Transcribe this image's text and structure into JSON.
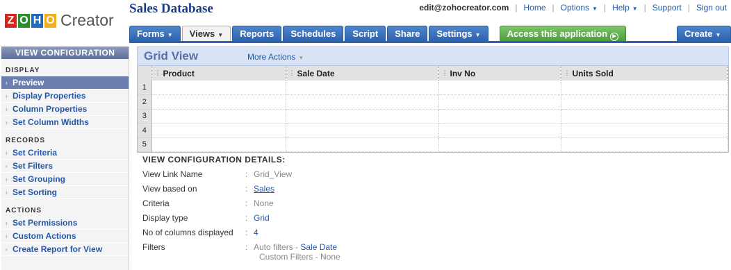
{
  "brand": {
    "logo_letters": [
      "Z",
      "O",
      "H",
      "O"
    ],
    "logo_word": "Creator"
  },
  "app_title": "Sales Database",
  "top_links": {
    "email": "edit@zohocreator.com",
    "home": "Home",
    "options": "Options",
    "help": "Help",
    "support": "Support",
    "sign_out": "Sign out"
  },
  "tabs": [
    {
      "label": "Forms",
      "has_caret": true
    },
    {
      "label": "Views",
      "has_caret": true,
      "active": true
    },
    {
      "label": "Reports"
    },
    {
      "label": "Schedules"
    },
    {
      "label": "Script"
    },
    {
      "label": "Share"
    },
    {
      "label": "Settings",
      "has_caret": true
    }
  ],
  "access_button": "Access this application",
  "create_button": "Create",
  "sidebar": {
    "heading": "VIEW CONFIGURATION",
    "sections": [
      {
        "title": "DISPLAY",
        "items": [
          "Preview",
          "Display Properties",
          "Column Properties",
          "Set Column Widths"
        ]
      },
      {
        "title": "RECORDS",
        "items": [
          "Set Criteria",
          "Set Filters",
          "Set Grouping",
          "Set Sorting"
        ]
      },
      {
        "title": "ACTIONS",
        "items": [
          "Set Permissions",
          "Custom Actions",
          "Create Report for View"
        ]
      }
    ],
    "active_item": "Preview"
  },
  "view": {
    "title": "Grid View",
    "more_actions": "More Actions"
  },
  "grid": {
    "columns": [
      "Product",
      "Sale Date",
      "Inv No",
      "Units Sold"
    ],
    "row_numbers": [
      "1",
      "2",
      "3",
      "4",
      "5"
    ]
  },
  "details": {
    "heading": "VIEW CONFIGURATION DETAILS:",
    "rows": [
      {
        "label": "View Link Name",
        "value": "Grid_View"
      },
      {
        "label": "View based on",
        "value": "Sales"
      },
      {
        "label": "Criteria",
        "value": "None"
      },
      {
        "label": "Display type",
        "value": "Grid"
      },
      {
        "label": "No of columns displayed",
        "value": "4"
      },
      {
        "label": "Filters",
        "value": "Auto filters - ",
        "value_link": "Sale Date",
        "value_line2": "Custom Filters - None"
      }
    ]
  },
  "colors": {
    "tab_blue": "#2d62ad",
    "access_green": "#4e9d3c",
    "link_blue": "#2358a8",
    "header_bg": "#d8e4f6"
  }
}
